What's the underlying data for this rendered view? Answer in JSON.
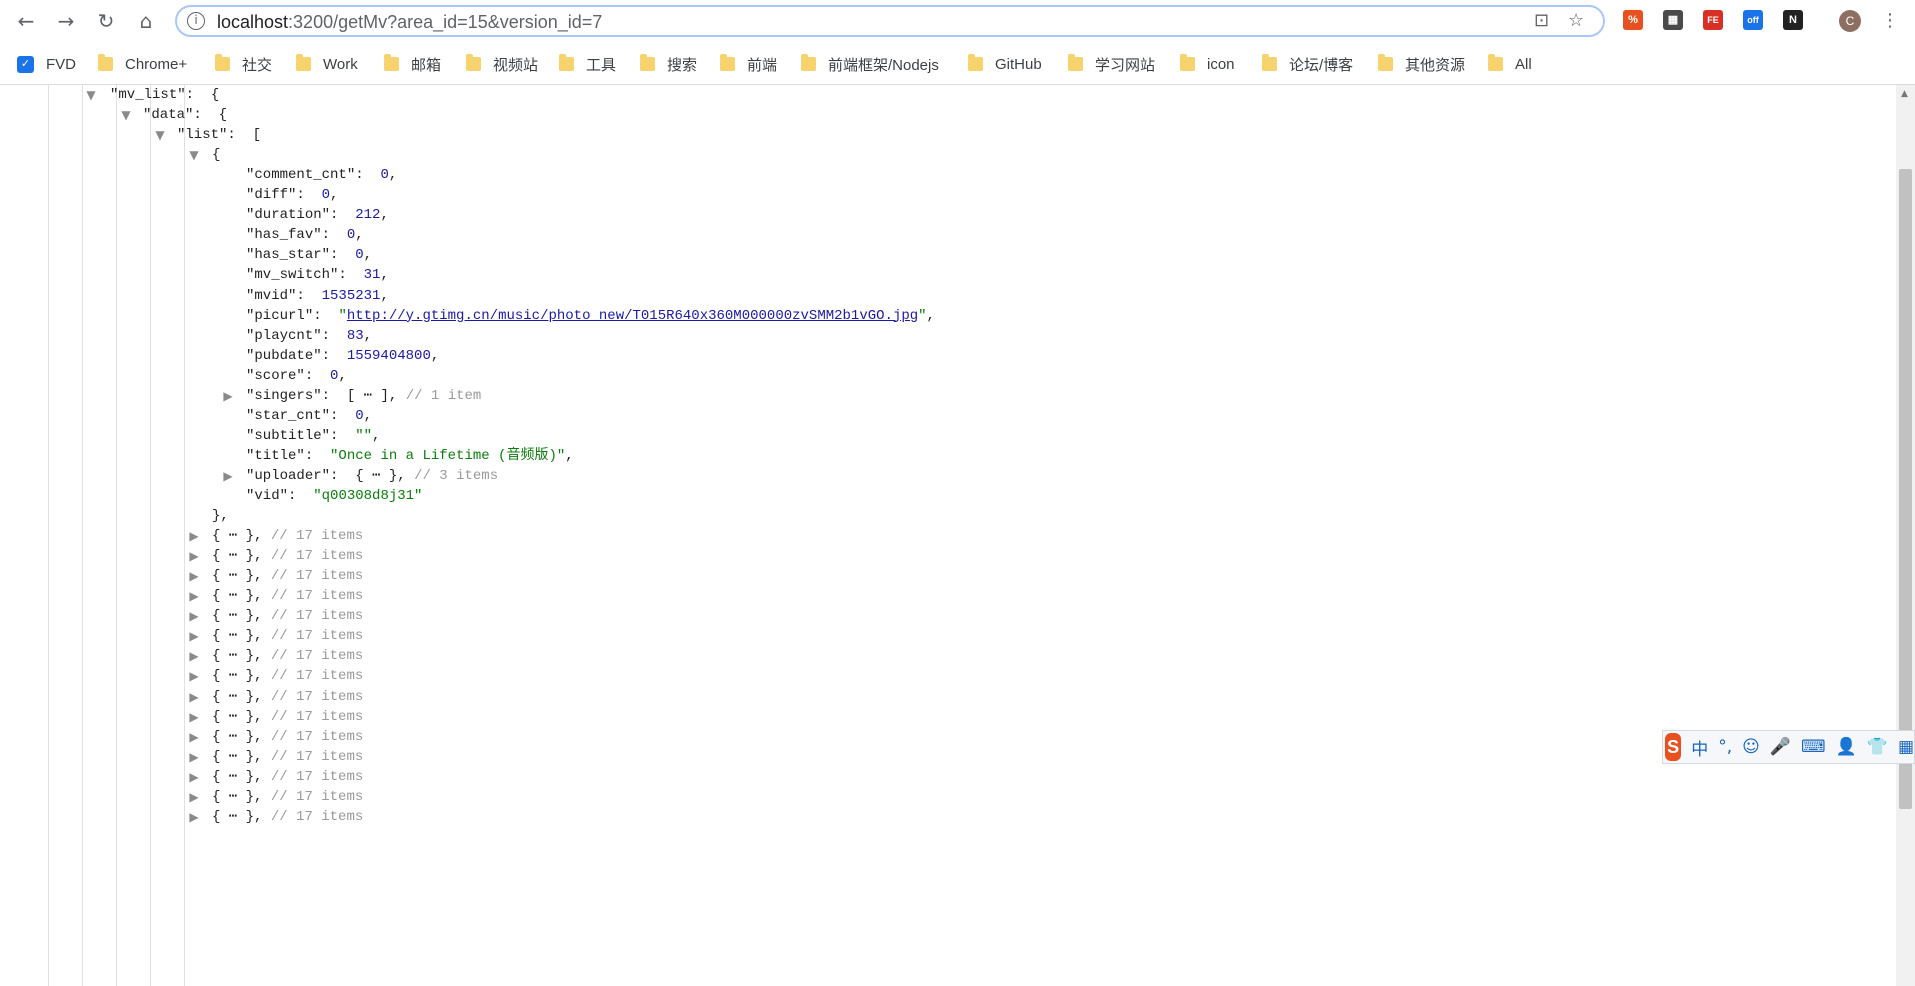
{
  "browser": {
    "url_host": "localhost",
    "url_rest": ":3200/getMv?area_id=15&version_id=7",
    "avatar_letter": "C",
    "extensions": [
      "%",
      "▦",
      "FE",
      "off",
      "N"
    ]
  },
  "bookmarks": [
    {
      "label": "FVD",
      "icon": "fvd-icon"
    },
    {
      "label": "Chrome+",
      "icon": "folder-icon"
    },
    {
      "label": "社交",
      "icon": "folder-icon"
    },
    {
      "label": "Work",
      "icon": "folder-icon"
    },
    {
      "label": "邮箱",
      "icon": "folder-icon"
    },
    {
      "label": "视频站",
      "icon": "folder-icon"
    },
    {
      "label": "工具",
      "icon": "folder-icon"
    },
    {
      "label": "搜索",
      "icon": "folder-icon"
    },
    {
      "label": "前端",
      "icon": "folder-icon"
    },
    {
      "label": "前端框架/Nodejs",
      "icon": "folder-icon"
    },
    {
      "label": "GitHub",
      "icon": "folder-icon"
    },
    {
      "label": "学习网站",
      "icon": "folder-icon"
    },
    {
      "label": "icon",
      "icon": "folder-icon"
    },
    {
      "label": "论坛/博客",
      "icon": "folder-icon"
    },
    {
      "label": "其他资源",
      "icon": "folder-icon"
    },
    {
      "label": "All",
      "icon": "folder-icon"
    }
  ],
  "json_view": {
    "root_key": "mv_list",
    "data_key": "data",
    "list_key": "list",
    "item": [
      {
        "key": "comment_cnt",
        "value": "0",
        "type": "number"
      },
      {
        "key": "diff",
        "value": "0",
        "type": "number"
      },
      {
        "key": "duration",
        "value": "212",
        "type": "number"
      },
      {
        "key": "has_fav",
        "value": "0",
        "type": "number"
      },
      {
        "key": "has_star",
        "value": "0",
        "type": "number"
      },
      {
        "key": "mv_switch",
        "value": "31",
        "type": "number"
      },
      {
        "key": "mvid",
        "value": "1535231",
        "type": "number"
      },
      {
        "key": "picurl",
        "value": "http://y.gtimg.cn/music/photo_new/T015R640x360M000000zvSMM2b1vGO.jpg",
        "type": "link"
      },
      {
        "key": "playcnt",
        "value": "83",
        "type": "number"
      },
      {
        "key": "pubdate",
        "value": "1559404800",
        "type": "number"
      },
      {
        "key": "score",
        "value": "0",
        "type": "number"
      },
      {
        "key": "singers",
        "value": "[ ⋯ ]",
        "type": "collapsed",
        "comment": "// 1 item"
      },
      {
        "key": "star_cnt",
        "value": "0",
        "type": "number"
      },
      {
        "key": "subtitle",
        "value": "\"\"",
        "type": "string"
      },
      {
        "key": "title",
        "value": "\"Once in a Lifetime (音频版)\"",
        "type": "string"
      },
      {
        "key": "uploader",
        "value": "{ ⋯ }",
        "type": "collapsed",
        "comment": "// 3 items"
      },
      {
        "key": "vid",
        "value": "\"q00308d8j31\"",
        "type": "string",
        "last": true
      }
    ],
    "collapsed_item_text": "{ ⋯ },",
    "collapsed_item_comment": "// 17 items",
    "collapsed_item_count": 15
  },
  "ime": {
    "logo": "S",
    "items": [
      "中",
      "°,",
      "☺",
      "🎤",
      "⌨",
      "👤",
      "👕",
      "▦"
    ]
  }
}
